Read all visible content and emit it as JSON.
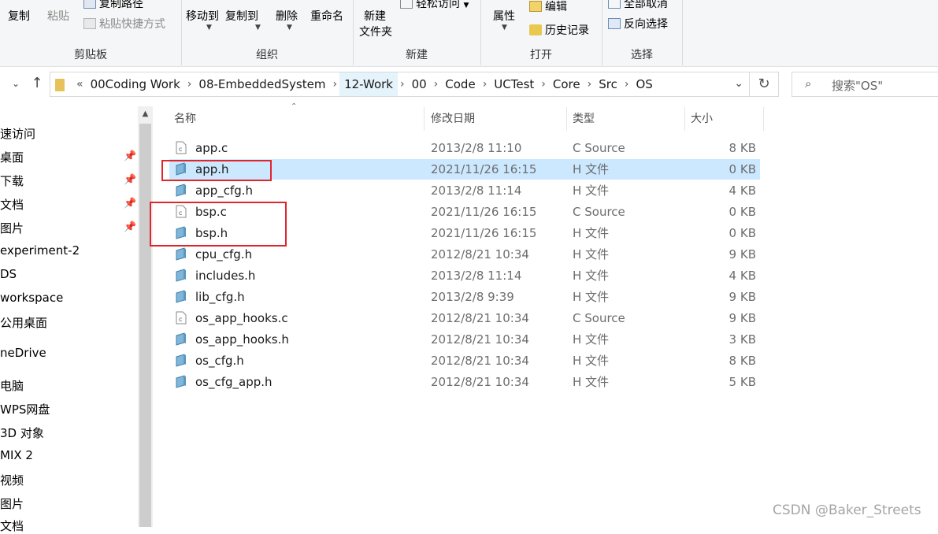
{
  "ribbon": {
    "groups": [
      {
        "label": "剪贴板",
        "items": [
          "复制",
          "粘贴",
          "复制路径",
          "粘贴快捷方式"
        ]
      },
      {
        "label": "组织",
        "items": [
          "移动到",
          "复制到",
          "删除",
          "重命名"
        ]
      },
      {
        "label": "新建",
        "items": [
          "新建\n文件夹",
          "轻松访问"
        ]
      },
      {
        "label": "打开",
        "items": [
          "属性",
          "编辑",
          "历史记录"
        ]
      },
      {
        "label": "选择",
        "items": [
          "全部取消",
          "反向选择"
        ]
      }
    ],
    "copy": "复制",
    "paste": "粘贴",
    "copy_path": "复制路径",
    "paste_shortcut": "粘贴快捷方式",
    "move_to": "移动到",
    "copy_to": "复制到",
    "delete": "删除",
    "rename": "重命名",
    "new_folder_1": "新建",
    "new_folder_2": "文件夹",
    "easy_access": "轻松访问",
    "properties": "属性",
    "edit": "编辑",
    "history": "历史记录",
    "select_none": "全部取消",
    "invert_selection": "反向选择",
    "label_clipboard": "剪贴板",
    "label_organize": "组织",
    "label_new": "新建",
    "label_open": "打开",
    "label_select": "选择"
  },
  "address": {
    "overflow": "«",
    "crumbs": [
      "00Coding Work",
      "08-EmbeddedSystem",
      "12-Work",
      "00",
      "Code",
      "UCTest",
      "Core",
      "Src",
      "OS"
    ],
    "search_placeholder": "搜索\"OS\""
  },
  "sidebar": {
    "items": [
      "速访问",
      "桌面",
      "下载",
      "文档",
      "图片",
      "experiment-2",
      "DS",
      "workspace",
      "公用桌面",
      "neDrive",
      "电脑",
      "WPS网盘",
      "3D 对象",
      "MIX 2",
      "视频",
      "图片",
      "文档"
    ]
  },
  "columns": {
    "name": "名称",
    "date": "修改日期",
    "type": "类型",
    "size": "大小"
  },
  "files": [
    {
      "name": "app.c",
      "date": "2013/2/8 11:10",
      "type": "C Source",
      "size": "8 KB",
      "kind": "c"
    },
    {
      "name": "app.h",
      "date": "2021/11/26 16:15",
      "type": "H 文件",
      "size": "0 KB",
      "kind": "h"
    },
    {
      "name": "app_cfg.h",
      "date": "2013/2/8 11:14",
      "type": "H 文件",
      "size": "4 KB",
      "kind": "h"
    },
    {
      "name": "bsp.c",
      "date": "2021/11/26 16:15",
      "type": "C Source",
      "size": "0 KB",
      "kind": "c"
    },
    {
      "name": "bsp.h",
      "date": "2021/11/26 16:15",
      "type": "H 文件",
      "size": "0 KB",
      "kind": "h"
    },
    {
      "name": "cpu_cfg.h",
      "date": "2012/8/21 10:34",
      "type": "H 文件",
      "size": "9 KB",
      "kind": "h"
    },
    {
      "name": "includes.h",
      "date": "2013/2/8 11:14",
      "type": "H 文件",
      "size": "4 KB",
      "kind": "h"
    },
    {
      "name": "lib_cfg.h",
      "date": "2013/2/8 9:39",
      "type": "H 文件",
      "size": "9 KB",
      "kind": "h"
    },
    {
      "name": "os_app_hooks.c",
      "date": "2012/8/21 10:34",
      "type": "C Source",
      "size": "9 KB",
      "kind": "c"
    },
    {
      "name": "os_app_hooks.h",
      "date": "2012/8/21 10:34",
      "type": "H 文件",
      "size": "3 KB",
      "kind": "h"
    },
    {
      "name": "os_cfg.h",
      "date": "2012/8/21 10:34",
      "type": "H 文件",
      "size": "8 KB",
      "kind": "h"
    },
    {
      "name": "os_cfg_app.h",
      "date": "2012/8/21 10:34",
      "type": "H 文件",
      "size": "5 KB",
      "kind": "h"
    }
  ],
  "watermark": "CSDN @Baker_Streets",
  "colors": {
    "selection": "#cce8ff",
    "highlight_box": "#e0262c",
    "folder": "#e7c25a"
  }
}
